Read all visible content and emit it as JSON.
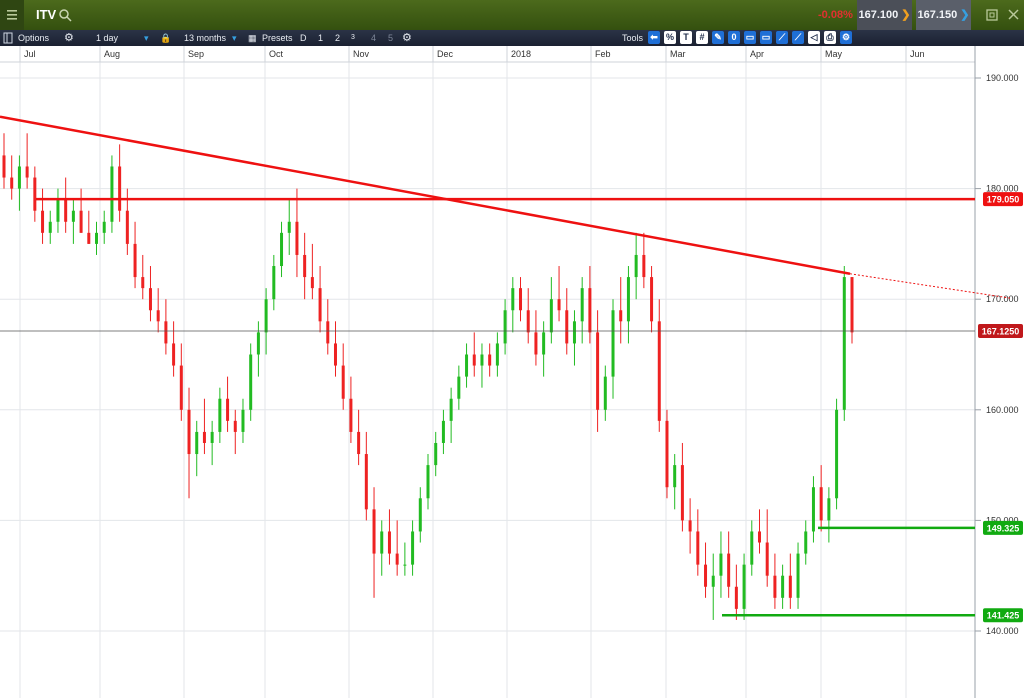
{
  "header": {
    "symbol": "ITV",
    "menu_icon": "hamburger-icon",
    "search_icon": "search-icon",
    "change_pct": "-0.08%",
    "sell_price": "167.100",
    "buy_price": "167.150",
    "maximize_icon": "maximize-icon",
    "close_icon": "close-icon"
  },
  "toolbar": {
    "options_label": "Options",
    "interval": "1 day",
    "range": "13 months",
    "presets_label": "Presets",
    "presets": [
      "D",
      "1",
      "2",
      "3",
      "4",
      "5"
    ],
    "tools_label": "Tools",
    "tool_icons": [
      "back-arrow-icon",
      "percent-icon",
      "text-tool-icon",
      "grid-icon",
      "drawing-tool-icon",
      "zero-icon",
      "window-icon",
      "window-icon",
      "trendline-icon",
      "trendline-icon",
      "tag-icon",
      "print-icon",
      "settings-icon"
    ]
  },
  "colors": {
    "up": "#22bb22",
    "down": "#ee2222",
    "trend": "#ee1111",
    "support": "#11aa11",
    "current_price_bg": "#c0181b",
    "header_bg": "#3f5d17"
  },
  "chart_data": {
    "type": "candlestick",
    "x_axis_labels": [
      "Jul",
      "Aug",
      "Sep",
      "Oct",
      "Nov",
      "Dec",
      "2018",
      "Feb",
      "Mar",
      "Apr",
      "May",
      "Jun"
    ],
    "y_axis_ticks": [
      "190.000",
      "180.000",
      "170.000",
      "160.000",
      "150.000",
      "140.000"
    ],
    "ylim": [
      136,
      191
    ],
    "grid": true,
    "current_price": 167.125,
    "current_price_label": "167.1250",
    "levels": [
      {
        "price": 179.05,
        "label": "179.050",
        "color": "red"
      },
      {
        "price": 149.325,
        "label": "149.325",
        "color": "green"
      },
      {
        "price": 141.425,
        "label": "141.425",
        "color": "green"
      }
    ],
    "trendline": {
      "start": [
        "Jun 2017",
        186.5
      ],
      "end": [
        "May 2018",
        172.3
      ],
      "projection_end": [
        "Jun 2018",
        170.1
      ]
    },
    "candles": [
      [
        183,
        185,
        180,
        181
      ],
      [
        181,
        183,
        179,
        180
      ],
      [
        180,
        183,
        178,
        182
      ],
      [
        182,
        185,
        180,
        181
      ],
      [
        181,
        182,
        177,
        178
      ],
      [
        178,
        180,
        175,
        176
      ],
      [
        176,
        178,
        175,
        177
      ],
      [
        177,
        180,
        176,
        179
      ],
      [
        179,
        181,
        176,
        177
      ],
      [
        177,
        179,
        175,
        178
      ],
      [
        178,
        180,
        176,
        176
      ],
      [
        176,
        178,
        175,
        175
      ],
      [
        175,
        177,
        174,
        176
      ],
      [
        176,
        178,
        175,
        177
      ],
      [
        177,
        183,
        176,
        182
      ],
      [
        182,
        184,
        177,
        178
      ],
      [
        178,
        180,
        174,
        175
      ],
      [
        175,
        177,
        171,
        172
      ],
      [
        172,
        174,
        170,
        171
      ],
      [
        171,
        173,
        168,
        169
      ],
      [
        169,
        171,
        167,
        168
      ],
      [
        168,
        170,
        165,
        166
      ],
      [
        166,
        168,
        163,
        164
      ],
      [
        164,
        166,
        159,
        160
      ],
      [
        160,
        162,
        152,
        156
      ],
      [
        156,
        159,
        154,
        158
      ],
      [
        158,
        161,
        156,
        157
      ],
      [
        157,
        159,
        155,
        158
      ],
      [
        158,
        162,
        157,
        161
      ],
      [
        161,
        163,
        158,
        159
      ],
      [
        159,
        160,
        156,
        158
      ],
      [
        158,
        161,
        157,
        160
      ],
      [
        160,
        166,
        159,
        165
      ],
      [
        165,
        168,
        163,
        167
      ],
      [
        167,
        171,
        165,
        170
      ],
      [
        170,
        174,
        169,
        173
      ],
      [
        173,
        177,
        172,
        176
      ],
      [
        176,
        179,
        174,
        177
      ],
      [
        177,
        180,
        172,
        174
      ],
      [
        174,
        176,
        170,
        172
      ],
      [
        172,
        175,
        170,
        171
      ],
      [
        171,
        173,
        167,
        168
      ],
      [
        168,
        170,
        165,
        166
      ],
      [
        166,
        168,
        163,
        164
      ],
      [
        164,
        166,
        160,
        161
      ],
      [
        161,
        163,
        157,
        158
      ],
      [
        158,
        160,
        155,
        156
      ],
      [
        156,
        158,
        150,
        151
      ],
      [
        151,
        153,
        143,
        147
      ],
      [
        147,
        150,
        145,
        149
      ],
      [
        149,
        151,
        146,
        147
      ],
      [
        147,
        150,
        145,
        146
      ],
      [
        146,
        148,
        145,
        146
      ],
      [
        146,
        150,
        145,
        149
      ],
      [
        149,
        153,
        148,
        152
      ],
      [
        152,
        156,
        151,
        155
      ],
      [
        155,
        158,
        154,
        157
      ],
      [
        157,
        160,
        156,
        159
      ],
      [
        159,
        162,
        157,
        161
      ],
      [
        161,
        164,
        160,
        163
      ],
      [
        163,
        166,
        162,
        165
      ],
      [
        165,
        167,
        163,
        164
      ],
      [
        164,
        166,
        162,
        165
      ],
      [
        165,
        166,
        163,
        164
      ],
      [
        164,
        167,
        163,
        166
      ],
      [
        166,
        170,
        165,
        169
      ],
      [
        169,
        172,
        167,
        171
      ],
      [
        171,
        172,
        168,
        169
      ],
      [
        169,
        171,
        166,
        167
      ],
      [
        167,
        169,
        164,
        165
      ],
      [
        165,
        168,
        163,
        167
      ],
      [
        167,
        172,
        166,
        170
      ],
      [
        170,
        173,
        168,
        169
      ],
      [
        169,
        171,
        165,
        166
      ],
      [
        166,
        169,
        164,
        168
      ],
      [
        168,
        172,
        166,
        171
      ],
      [
        171,
        173,
        166,
        167
      ],
      [
        167,
        169,
        158,
        160
      ],
      [
        160,
        164,
        159,
        163
      ],
      [
        163,
        170,
        161,
        169
      ],
      [
        169,
        172,
        166,
        168
      ],
      [
        168,
        173,
        166,
        172
      ],
      [
        172,
        176,
        170,
        174
      ],
      [
        174,
        176,
        171,
        172
      ],
      [
        172,
        173,
        167,
        168
      ],
      [
        168,
        170,
        158,
        159
      ],
      [
        159,
        160,
        152,
        153
      ],
      [
        153,
        156,
        151,
        155
      ],
      [
        155,
        157,
        149,
        150
      ],
      [
        150,
        152,
        147,
        149
      ],
      [
        149,
        151,
        145,
        146
      ],
      [
        146,
        148,
        143,
        144
      ],
      [
        144,
        147,
        141,
        145
      ],
      [
        145,
        149,
        143,
        147
      ],
      [
        147,
        149,
        143,
        144
      ],
      [
        144,
        146,
        141,
        142
      ],
      [
        142,
        147,
        141,
        146
      ],
      [
        146,
        150,
        145,
        149
      ],
      [
        149,
        151,
        147,
        148
      ],
      [
        148,
        151,
        144,
        145
      ],
      [
        145,
        147,
        142,
        143
      ],
      [
        143,
        146,
        142,
        145
      ],
      [
        145,
        147,
        142,
        143
      ],
      [
        143,
        148,
        142,
        147
      ],
      [
        147,
        150,
        146,
        149
      ],
      [
        149,
        154,
        148,
        153
      ],
      [
        153,
        155,
        149,
        150
      ],
      [
        150,
        153,
        148,
        152
      ],
      [
        152,
        161,
        151,
        160
      ],
      [
        160,
        173,
        159,
        172
      ],
      [
        172,
        172,
        166,
        167
      ]
    ]
  }
}
